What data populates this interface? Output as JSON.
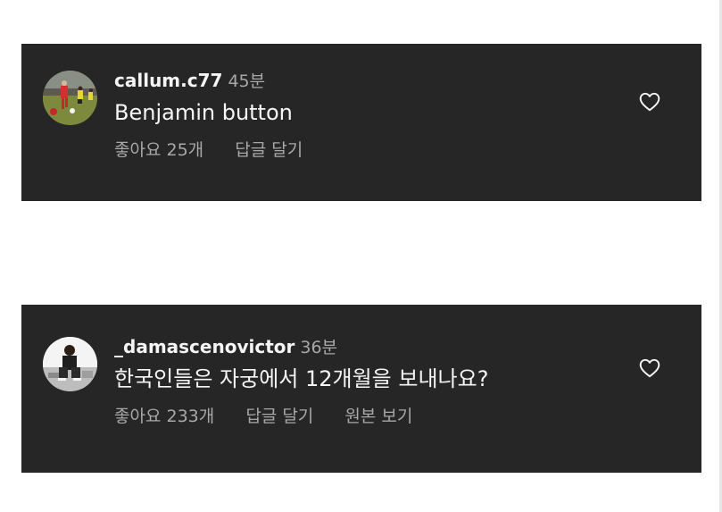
{
  "comments": [
    {
      "username": "callum.c77",
      "time": "45분",
      "text": "Benjamin button",
      "likes_label": "좋아요 25개",
      "reply_label": "답글 달기",
      "avatar_icon": "soccer-player-avatar",
      "heart_icon": "heart-outline-icon"
    },
    {
      "username": "_damascenovictor",
      "time": "36분",
      "text": "한국인들은 자궁에서 12개월을 보내나요?",
      "likes_label": "좋아요 233개",
      "reply_label": "답글 달기",
      "translate_label": "원본 보기",
      "avatar_icon": "person-sitting-avatar",
      "heart_icon": "heart-outline-icon"
    }
  ],
  "colors": {
    "card_background": "#262626",
    "primary_text": "#f5f5f5",
    "secondary_text": "#a8a8a8",
    "page_background": "#ffffff"
  }
}
